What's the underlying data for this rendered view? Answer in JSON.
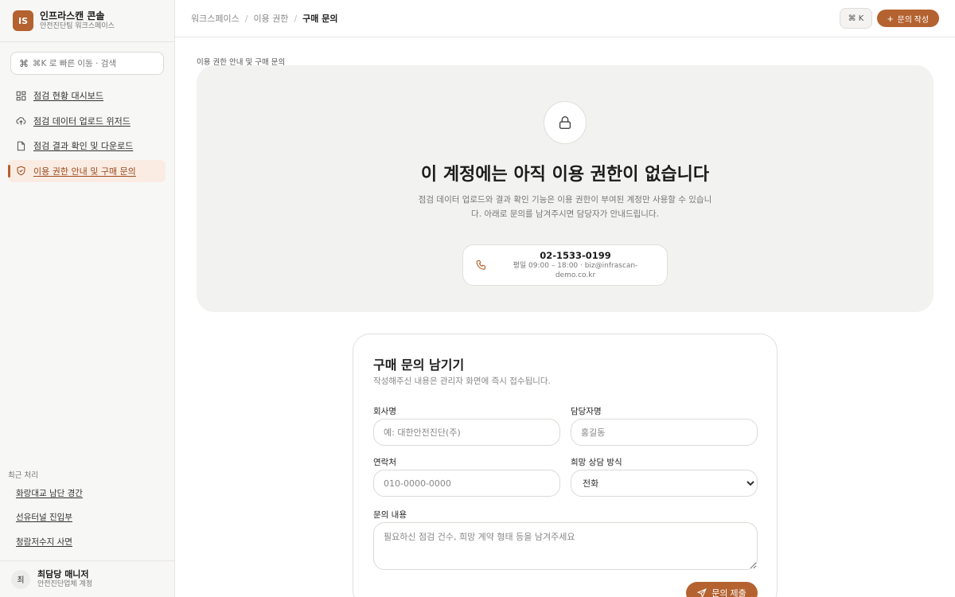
{
  "brand": {
    "logo": "IS",
    "name": "인프라스캔 콘솔",
    "subtitle": "안전진단팀 워크스페이스"
  },
  "search": {
    "shortcut_glyph": "⌘",
    "placeholder": "⌘K 로 빠른 이동 · 검색"
  },
  "sidebar": {
    "items": [
      {
        "label": "점검 현황 대시보드",
        "icon": "dashboard-icon",
        "active": false
      },
      {
        "label": "점검 데이터 업로드 위저드",
        "icon": "upload-cloud-icon",
        "active": false
      },
      {
        "label": "점검 결과 확인 및 다운로드",
        "icon": "file-icon",
        "active": false
      },
      {
        "label": "이용 권한 안내 및 구매 문의",
        "icon": "shield-icon",
        "active": true
      }
    ],
    "recent_title": "최근 처리",
    "recent": [
      "화랑대교 남단 경간",
      "선유터널 진입부",
      "청람저수지 사면"
    ]
  },
  "user": {
    "avatar": "최",
    "name": "최담당 매니저",
    "org": "안전진단업체 계정"
  },
  "header": {
    "breadcrumb": [
      "워크스페이스",
      "이용 권한",
      "구매 문의"
    ],
    "separator": "/",
    "shortcut_label": "⌘ K",
    "new_button_label": "문의 작성",
    "new_button_glyph": "+"
  },
  "main": {
    "section_label": "이용 권한 안내 및 구매 문의",
    "lock": {
      "title": "이 계정에는 아직 이용 권한이 없습니다",
      "description": "점검 데이터 업로드와 결과 확인 기능은 이용 권한이 부여된 계정만 사용할 수 있습니다. 아래로 문의를 남겨주시면 담당자가 안내드립니다.",
      "phone": "02-1533-0199",
      "hours": "평일 09:00 – 18:00 · biz@infrascan-demo.co.kr"
    },
    "form": {
      "title": "구매 문의 남기기",
      "subtitle": "작성해주신 내용은 관리자 화면에 즉시 접수됩니다.",
      "company": {
        "label": "회사명",
        "placeholder": "예: 대한안전진단(주)",
        "value": ""
      },
      "manager": {
        "label": "담당자명",
        "placeholder": "홍길동",
        "value": ""
      },
      "contact": {
        "label": "연락처",
        "placeholder": "010-0000-0000",
        "value": ""
      },
      "method": {
        "label": "희망 상담 방식",
        "selected": "전화"
      },
      "message": {
        "label": "문의 내용",
        "placeholder": "필요하신 점검 건수, 희망 계약 형태 등을 남겨주세요",
        "value": ""
      },
      "submit_label": "문의 제출"
    }
  },
  "colors": {
    "accent": "#b4622f",
    "active_bg": "#fbece3",
    "panel_bg": "#f2f2f1",
    "sidebar_bg": "#f7f7f6"
  }
}
